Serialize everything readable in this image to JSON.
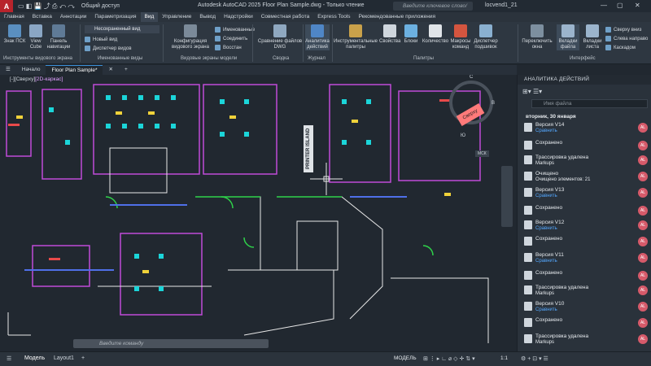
{
  "titlebar": {
    "app_letter": "A",
    "share_label": "Общий доступ",
    "title": "Autodesk AutoCAD 2025   Floor Plan Sample.dwg - Только чтение",
    "search_placeholder": "Введите ключевое слово/фразу",
    "user": "locvend1_21"
  },
  "ribbon_tabs": [
    "Главная",
    "Вставка",
    "Аннотации",
    "Параметризация",
    "Вид",
    "Управление",
    "Вывод",
    "Надстройки",
    "Совместная работа",
    "Express Tools",
    "Рекомендованные приложения"
  ],
  "ribbon": {
    "ucs_label": "Знак ПСК",
    "viewcube_label": "View Cube",
    "navpanel_label": "Панель навигации",
    "view_combo": "Несохраненный вид",
    "new_view": "Новый вид",
    "view_manager": "Диспетчер видов",
    "config_label": "Конфигурация видового экрана",
    "named": "Именованные",
    "join": "Соединить",
    "restore": "Восстан",
    "compare_label": "Сравнение файлов DWG",
    "analytics_label": "Аналитика действий",
    "tool_palettes": "Инструментальные палитры",
    "properties": "Свойства",
    "blocks": "Блоки",
    "count": "Количество",
    "macros": "Макросы команд",
    "sheet_mgr": "Диспетчер подшивок",
    "switch_windows": "Переключить окна",
    "file_tabs": "Вкладки файла",
    "layout_tabs": "Вкладки листа",
    "tile_down": "Сверху вниз",
    "tile_left": "Слева направо",
    "cascade": "Каскадом",
    "panels": [
      "Инструменты видового экрана",
      "Именованные виды",
      "Видовые экраны модели",
      "Сводка",
      "Журнал",
      "Палитры",
      "Интерфейс"
    ]
  },
  "doc_tabs": {
    "start": "Начало",
    "file": "Floor Plan Sample*"
  },
  "canvas": {
    "view_label_prefix": "[-][Сверху]",
    "view_label_style": "[2D-каркас]",
    "cmd_placeholder": "Введите  команду",
    "printer_label": "PRINTER ISLAND",
    "viewcube_top": "Сверху",
    "compass_c": "С",
    "compass_v": "В",
    "compass_yu": "Ю",
    "mck": "МСК"
  },
  "status": {
    "model_tab": "Модель",
    "layout_tab": "Layout1",
    "model_btn": "МОДЕЛЬ",
    "scale": "1:1"
  },
  "analytics": {
    "header": "АНАЛИТИКА ДЕЙСТВИЙ",
    "search_placeholder": "Имя файла",
    "date": "вторник, 30 января",
    "entries": [
      {
        "t1": "Версия V14",
        "t2": "Сравнить",
        "link": true
      },
      {
        "t1": "Сохранено",
        "t2": "",
        "link": false
      },
      {
        "t1": "Трассировка удалена",
        "t2": "Markups",
        "link": false
      },
      {
        "t1": "Очищено",
        "t2": "Очищено элементов: 21",
        "link": false
      },
      {
        "t1": "Версия V13",
        "t2": "Сравнить",
        "link": true
      },
      {
        "t1": "Сохранено",
        "t2": "",
        "link": false
      },
      {
        "t1": "Версия V12",
        "t2": "Сравнить",
        "link": true
      },
      {
        "t1": "Сохранено",
        "t2": "",
        "link": false
      },
      {
        "t1": "Версия V11",
        "t2": "Сравнить",
        "link": true
      },
      {
        "t1": "Сохранено",
        "t2": "",
        "link": false
      },
      {
        "t1": "Трассировка удалена",
        "t2": "Markups",
        "link": false
      },
      {
        "t1": "Версия V10",
        "t2": "Сравнить",
        "link": true
      },
      {
        "t1": "Сохранено",
        "t2": "",
        "link": false
      },
      {
        "t1": "Трассировка удалена",
        "t2": "Markups",
        "link": false
      }
    ],
    "avatar": "AL"
  }
}
